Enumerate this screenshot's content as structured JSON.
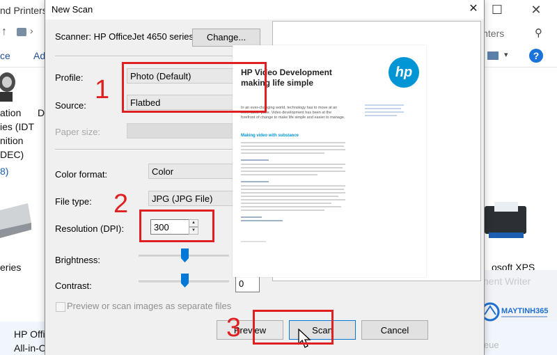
{
  "background_window": {
    "title": "nd Printers",
    "search_placeholder": "inters",
    "toolbar": [
      "ce",
      "Ad"
    ],
    "device1_lines": [
      "ation",
      "ies (IDT",
      "nition",
      "DEC)",
      "8)"
    ],
    "device1_d": "D",
    "device2_label": "eries",
    "device3_label": "osoft XPS",
    "watermark_text": "nent Writer",
    "status_lines": [
      "HP Offi",
      "All-in-O"
    ],
    "status_right": "leue"
  },
  "dialog": {
    "title": "New Scan",
    "scanner_label": "Scanner: HP OfficeJet 4650 series...",
    "change_button": "Change...",
    "profile": {
      "label": "Profile:",
      "value": "Photo (Default)"
    },
    "source": {
      "label": "Source:",
      "value": "Flatbed"
    },
    "paper_size": {
      "label": "Paper size:",
      "value": ""
    },
    "color_format": {
      "label": "Color format:",
      "value": "Color"
    },
    "file_type": {
      "label": "File type:",
      "value": "JPG (JPG File)"
    },
    "resolution": {
      "label": "Resolution (DPI):",
      "value": "300"
    },
    "brightness": {
      "label": "Brightness:",
      "value": "0"
    },
    "contrast": {
      "label": "Contrast:",
      "value": "0"
    },
    "separate_files": {
      "label": "Preview or scan images as separate files",
      "checked": false
    },
    "buttons": {
      "preview": "Preview",
      "scan": "Scan",
      "cancel": "Cancel"
    }
  },
  "preview_document": {
    "title_line1": "HP Video Development",
    "title_line2": "making life simple",
    "logo": "hp",
    "intro": "In an ever-changing world, technology has to move at an even faster pace. Video development has been at the forefront of change to make life simple and easier to manage.",
    "subheading": "Making video with substance"
  },
  "annotations": {
    "step1": "1",
    "step2": "2",
    "step3": "3"
  },
  "colors": {
    "accent": "#0078d7",
    "annotation_red": "#e02020",
    "hp_blue": "#0096d6"
  }
}
